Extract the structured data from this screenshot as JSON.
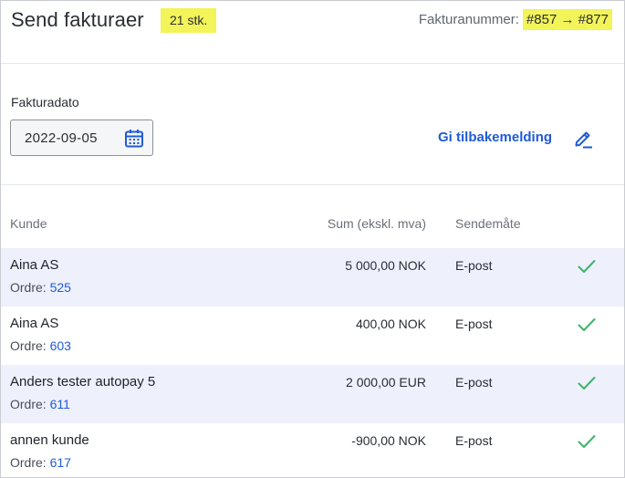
{
  "header": {
    "title": "Send fakturaer",
    "count_badge": "21 stk.",
    "invoice_label": "Fakturanummer:",
    "invoice_range": "#857 → #877"
  },
  "date_section": {
    "label": "Fakturadato",
    "date_value": "2022-09-05",
    "calendar_icon": "calendar-icon",
    "feedback_link": "Gi tilbakemelding",
    "edit_icon": "pencil-icon"
  },
  "table": {
    "columns": [
      "Kunde",
      "Sum (ekskl. mva)",
      "Sendemåte"
    ],
    "order_prefix": "Ordre:",
    "rows": [
      {
        "customer": "Aina AS",
        "order": "525",
        "amount": "5 000,00 NOK",
        "method": "E-post"
      },
      {
        "customer": "Aina AS",
        "order": "603",
        "amount": "400,00 NOK",
        "method": "E-post"
      },
      {
        "customer": "Anders tester autopay 5",
        "order": "611",
        "amount": "2 000,00 EUR",
        "method": "E-post"
      },
      {
        "customer": "annen kunde",
        "order": "617",
        "amount": "-900,00 NOK",
        "method": "E-post"
      }
    ]
  },
  "colors": {
    "highlight": "#f3f35a",
    "link": "#1f5bd8",
    "check": "#3fb36b",
    "row_shade": "#eef0fb"
  }
}
